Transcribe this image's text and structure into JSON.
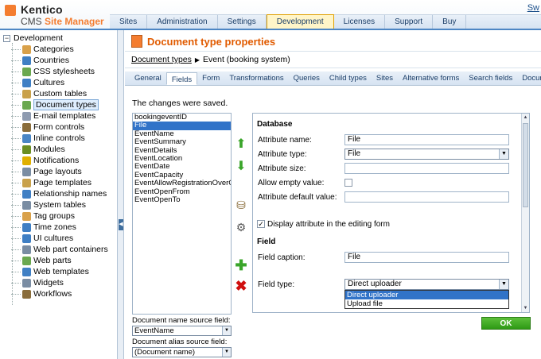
{
  "header": {
    "brand_line1": "Kentico",
    "brand_line2_a": "CMS ",
    "brand_line2_b": "Site Manager",
    "switch_link": "Sw",
    "tabs": [
      "Sites",
      "Administration",
      "Settings",
      "Development",
      "Licenses",
      "Support",
      "Buy"
    ],
    "active_tab": "Development"
  },
  "tree": {
    "root": "Development",
    "items": [
      {
        "label": "Categories",
        "icon": "categories-icon",
        "color": "#d9a14a"
      },
      {
        "label": "Countries",
        "icon": "globe-icon",
        "color": "#3f7fc4"
      },
      {
        "label": "CSS stylesheets",
        "icon": "stylesheet-icon",
        "color": "#6aa84f"
      },
      {
        "label": "Cultures",
        "icon": "globe-icon",
        "color": "#3f7fc4"
      },
      {
        "label": "Custom tables",
        "icon": "table-icon",
        "color": "#c9a14a"
      },
      {
        "label": "Document types",
        "icon": "document-types-icon",
        "color": "#6aa84f"
      },
      {
        "label": "E-mail templates",
        "icon": "email-icon",
        "color": "#8e9bb0"
      },
      {
        "label": "Form controls",
        "icon": "form-controls-icon",
        "color": "#8a6d3b"
      },
      {
        "label": "Inline controls",
        "icon": "inline-controls-icon",
        "color": "#4a86c5"
      },
      {
        "label": "Modules",
        "icon": "modules-icon",
        "color": "#6b8e23"
      },
      {
        "label": "Notifications",
        "icon": "notifications-icon",
        "color": "#e0b000"
      },
      {
        "label": "Page layouts",
        "icon": "page-layouts-icon",
        "color": "#7a8da3"
      },
      {
        "label": "Page templates",
        "icon": "page-templates-icon",
        "color": "#c9a14a"
      },
      {
        "label": "Relationship names",
        "icon": "relationship-icon",
        "color": "#3f7fc4"
      },
      {
        "label": "System tables",
        "icon": "system-tables-icon",
        "color": "#7a8da3"
      },
      {
        "label": "Tag groups",
        "icon": "tag-groups-icon",
        "color": "#d9a14a"
      },
      {
        "label": "Time zones",
        "icon": "time-zones-icon",
        "color": "#3f7fc4"
      },
      {
        "label": "UI cultures",
        "icon": "ui-cultures-icon",
        "color": "#3f7fc4"
      },
      {
        "label": "Web part containers",
        "icon": "web-part-containers-icon",
        "color": "#7a8da3"
      },
      {
        "label": "Web parts",
        "icon": "web-parts-icon",
        "color": "#6aa84f"
      },
      {
        "label": "Web templates",
        "icon": "web-templates-icon",
        "color": "#3f7fc4"
      },
      {
        "label": "Widgets",
        "icon": "widgets-icon",
        "color": "#7a8da3"
      },
      {
        "label": "Workflows",
        "icon": "workflows-icon",
        "color": "#8a6d3b"
      }
    ],
    "selected": "Document types"
  },
  "main": {
    "title": "Document type properties",
    "breadcrumb_link": "Document types",
    "breadcrumb_current": "Event (booking system)",
    "subtabs": [
      "General",
      "Fields",
      "Form",
      "Transformations",
      "Queries",
      "Child types",
      "Sites",
      "Alternative forms",
      "Search fields",
      "Documents"
    ],
    "active_subtab": "Fields",
    "saved_message": "The changes were saved.",
    "fields": [
      "bookingeventID",
      "File",
      "EventName",
      "EventSummary",
      "EventDetails",
      "EventLocation",
      "EventDate",
      "EventCapacity",
      "EventAllowRegistrationOverCapa",
      "EventOpenFrom",
      "EventOpenTo"
    ],
    "selected_field": "File",
    "panel": {
      "database_header": "Database",
      "attr_name_label": "Attribute name:",
      "attr_name_value": "File",
      "attr_type_label": "Attribute type:",
      "attr_type_value": "File",
      "attr_size_label": "Attribute size:",
      "attr_size_value": "",
      "allow_empty_label": "Allow empty value:",
      "allow_empty_checked": false,
      "attr_default_label": "Attribute default value:",
      "attr_default_value": "",
      "display_label": "Display attribute in the editing form",
      "display_checked": true,
      "field_header": "Field",
      "field_caption_label": "Field caption:",
      "field_caption_value": "File",
      "field_type_label": "Field type:",
      "field_type_value": "Direct uploader",
      "field_type_options": [
        "Direct uploader",
        "Upload file"
      ],
      "field_type_highlighted": "Direct uploader"
    },
    "doc_name_source_label": "Document name source field:",
    "doc_name_source_value": "EventName",
    "doc_alias_source_label": "Document alias source field:",
    "doc_alias_source_value": "(Document name)",
    "ok_label": "OK"
  }
}
